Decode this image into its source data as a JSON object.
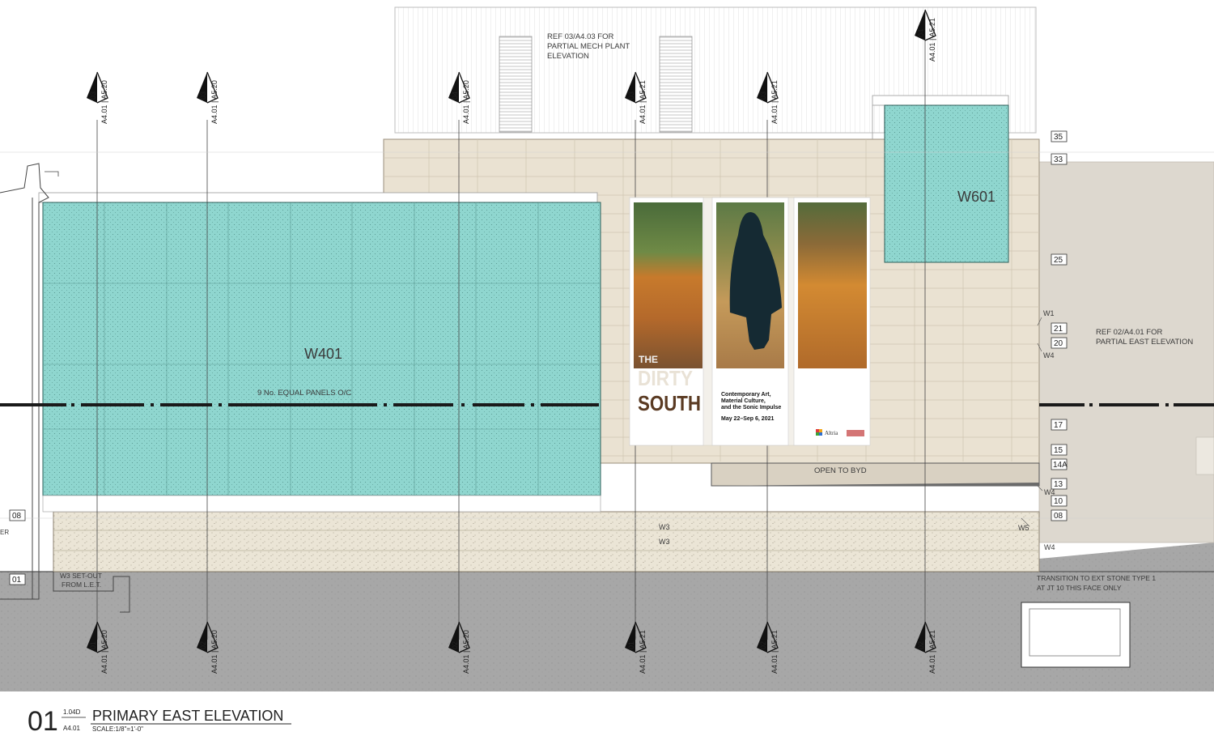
{
  "notes": {
    "mech_plant": [
      "REF 03/A4.03 FOR",
      "PARTIAL MECH PLANT",
      "ELEVATION"
    ],
    "partial_east": [
      "REF 02/A4.01 FOR",
      "PARTIAL  EAST ELEVATION"
    ],
    "equal_panels": "9 No. EQUAL PANELS O/C",
    "open_to_byd": "OPEN TO BYD",
    "w3_setout": [
      "W3 SET-OUT",
      "FROM L.E.T."
    ],
    "transition": [
      "TRANSITION TO EXT STONE TYPE 1",
      "AT JT 10 THIS FACE ONLY"
    ],
    "left_edge": "ER"
  },
  "panels": {
    "w401": "W401",
    "w601": "W601"
  },
  "wall_tags": {
    "w1": "W1",
    "w4_upper": "W4",
    "w4_mid": "W4",
    "w4_lower": "W4",
    "w5": "W5",
    "w3_a": "W3",
    "w3_b": "W3"
  },
  "levels": {
    "l35": "35",
    "l33": "33",
    "l25": "25",
    "l21": "21",
    "l20": "20",
    "l17": "17",
    "l15": "15",
    "l14a": "14A",
    "l13": "13",
    "l10": "10",
    "l08_right": "08",
    "l08_left": "08",
    "l01_left": "01"
  },
  "section_markers_top": [
    {
      "num": "03",
      "ref": "A4.01 | A5.20"
    },
    {
      "num": "03",
      "ref": "A4.01 | A5.20"
    },
    {
      "num": "04",
      "ref": "A4.01 | A5.20"
    },
    {
      "num": "03",
      "ref": "A4.01 | A5.21"
    },
    {
      "num": "03",
      "ref": "A4.01 | A5.21"
    },
    {
      "num": "04",
      "ref": "A4.01 | A5.21"
    }
  ],
  "section_markers_bottom": [
    {
      "num": "01",
      "ref": "A4.01 | A5.20"
    },
    {
      "num": "02",
      "ref": "A4.01 | A5.20"
    },
    {
      "num": "02",
      "ref": "A4.01 | A5.20"
    },
    {
      "num": "01",
      "ref": "A4.01 | A5.21"
    },
    {
      "num": "02",
      "ref": "A4.01 | A5.21"
    },
    {
      "num": "02",
      "ref": "A4.01 | A5.21"
    }
  ],
  "banners": {
    "title_line1": "THE",
    "title_line2": "DIRTY",
    "title_line3": "SOUTH",
    "subtitle": [
      "Contemporary Art,",
      "Material Culture,",
      "and the Sonic Impulse"
    ],
    "dates": "May 22–Sep 6, 2021",
    "sponsor": "Altria"
  },
  "title_block": {
    "number": "01",
    "sheet_top": "1.04D",
    "sheet_bottom": "A4.01",
    "title": "PRIMARY EAST ELEVATION",
    "scale": "SCALE:1/8\"=1'-0\""
  },
  "colors": {
    "glass": "#8fd6cf",
    "stone": "#eae2d2",
    "ground": "#a9a9a9",
    "base_stone": "#ece6d8",
    "neighbor": "#ddd8cf"
  }
}
